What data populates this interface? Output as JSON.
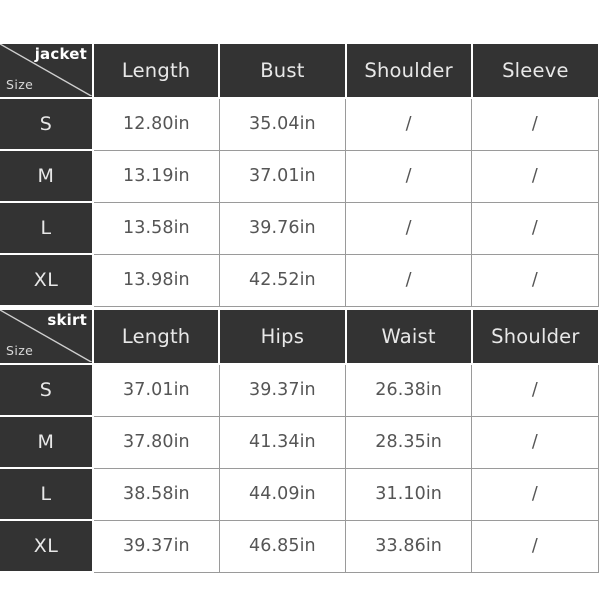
{
  "background_color": "#ffffff",
  "header_bg_color": "#333333",
  "header_text_color": "#e8e8e8",
  "data_text_color": "#555555",
  "grid_line_color": "#9a9a9a",
  "tables": [
    {
      "id": "jacket-size-table",
      "corner": {
        "category": "jacket",
        "size_label": "Size",
        "diagonal": true
      },
      "columns": [
        "Length",
        "Bust",
        "Shoulder",
        "Sleeve"
      ],
      "rows": [
        {
          "size": "S",
          "values": [
            "12.80in",
            "35.04in",
            "/",
            "/"
          ]
        },
        {
          "size": "M",
          "values": [
            "13.19in",
            "37.01in",
            "/",
            "/"
          ]
        },
        {
          "size": "L",
          "values": [
            "13.58in",
            "39.76in",
            "/",
            "/"
          ]
        },
        {
          "size": "XL",
          "values": [
            "13.98in",
            "42.52in",
            "/",
            "/"
          ]
        }
      ]
    },
    {
      "id": "skirt-size-table",
      "corner": {
        "category": "skirt",
        "size_label": "Size",
        "diagonal": true
      },
      "columns": [
        "Length",
        "Hips",
        "Waist",
        "Shoulder"
      ],
      "rows": [
        {
          "size": "S",
          "values": [
            "37.01in",
            "39.37in",
            "26.38in",
            "/"
          ]
        },
        {
          "size": "M",
          "values": [
            "37.80in",
            "41.34in",
            "28.35in",
            "/"
          ]
        },
        {
          "size": "L",
          "values": [
            "38.58in",
            "44.09in",
            "31.10in",
            "/"
          ]
        },
        {
          "size": "XL",
          "values": [
            "39.37in",
            "46.85in",
            "33.86in",
            "/"
          ]
        }
      ]
    }
  ]
}
